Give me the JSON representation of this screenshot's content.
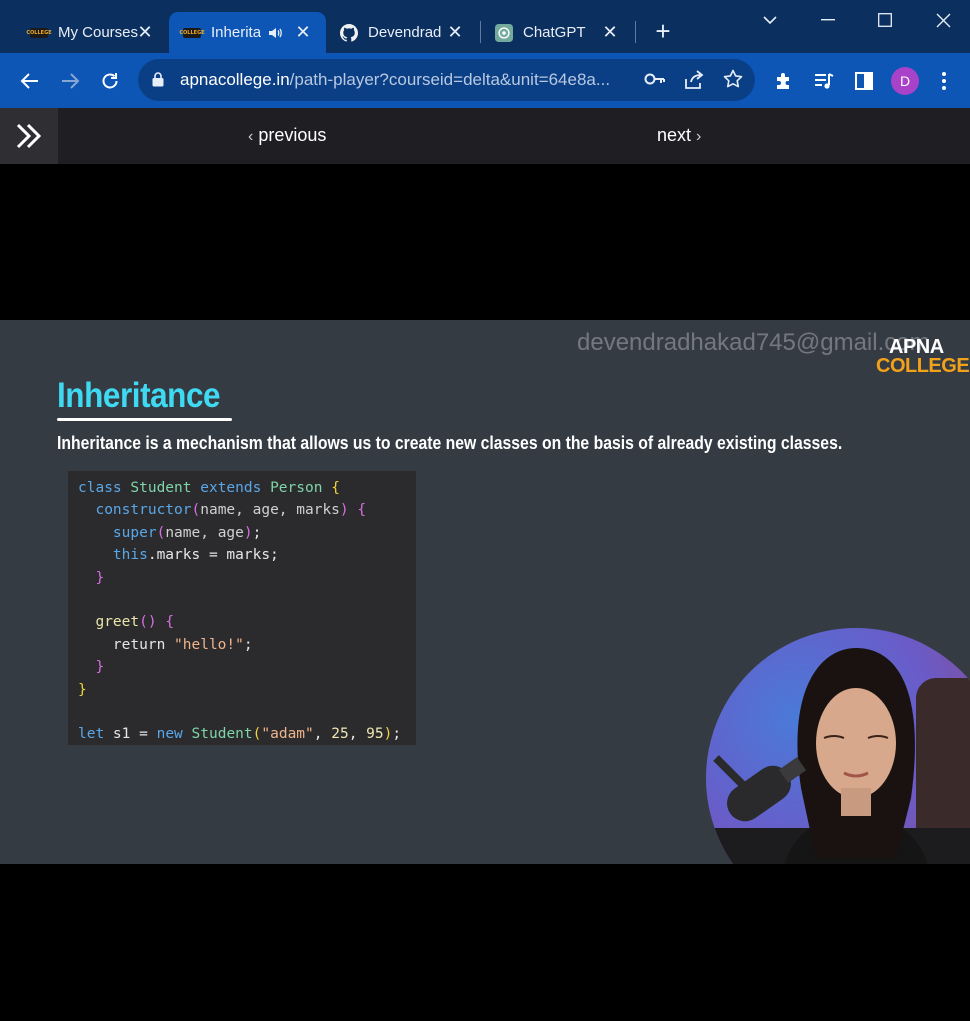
{
  "browser": {
    "tabs": [
      {
        "title": "My Courses",
        "favicon": "apna-college-favicon",
        "active": false
      },
      {
        "title": "Inherita",
        "favicon": "apna-college-favicon",
        "active": true,
        "audio": true
      },
      {
        "title": "Devendrad",
        "favicon": "github-icon",
        "active": false
      },
      {
        "title": "ChatGPT",
        "favicon": "chatgpt-icon",
        "active": false
      }
    ],
    "address": {
      "domain": "apnacollege.in",
      "path": "/path-player?courseid=delta&unit=64e8a..."
    },
    "profile_initial": "D",
    "profile_color": "#a842c8",
    "accent_color": "#0d56b6"
  },
  "course_nav": {
    "previous_label": "previous",
    "next_label": "next"
  },
  "slide": {
    "watermark": "devendradhakad745@gmail.com",
    "brand_line1": "APNA",
    "brand_line2": "COLLEGE",
    "title": "Inheritance",
    "description": "Inheritance is a mechanism that allows us to create new classes on the basis of already existing classes.",
    "code_lines": [
      "class Student extends Person {",
      "  constructor(name, age, marks) {",
      "    super(name, age);",
      "    this.marks = marks;",
      "  }",
      "",
      "  greet() {",
      "    return \"hello!\";",
      "  }",
      "}",
      "",
      "let s1 = new Student(\"adam\", 25, 95);"
    ]
  },
  "video": {
    "progress": 0.0
  }
}
